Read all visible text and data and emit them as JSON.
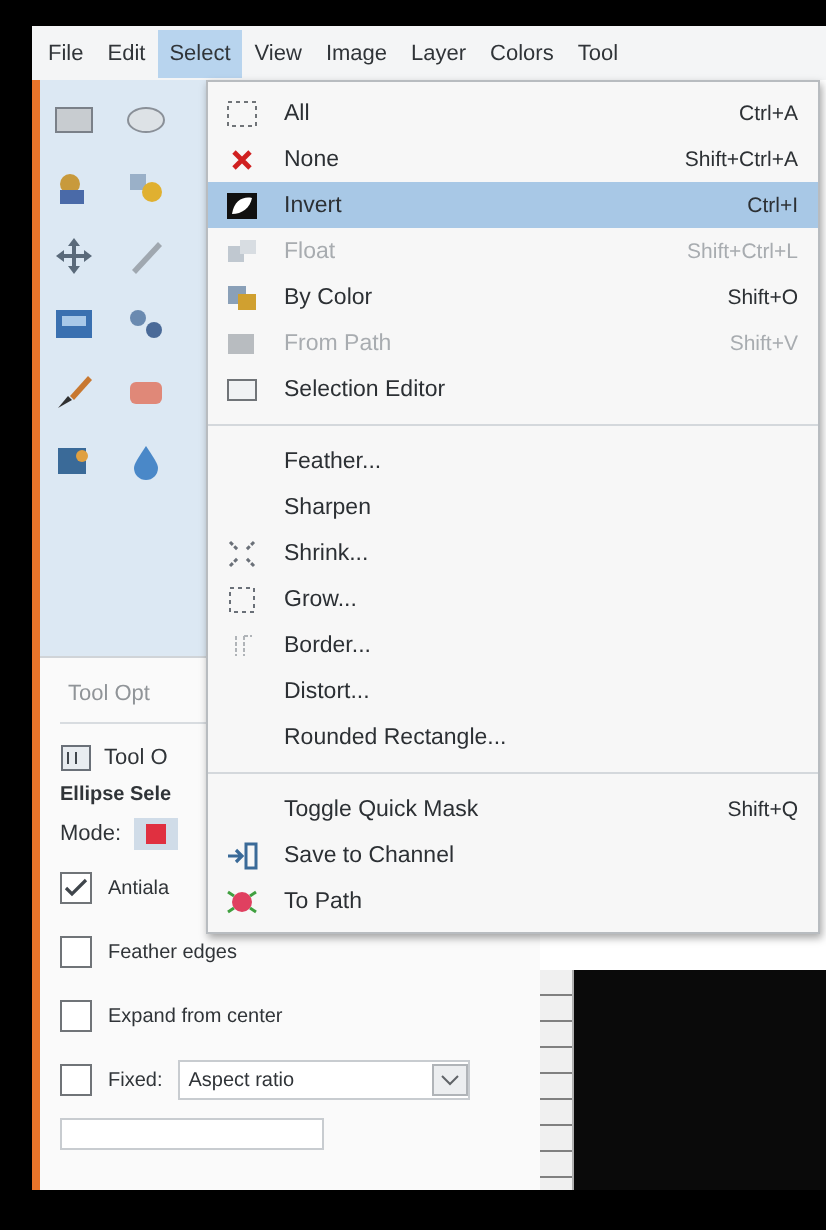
{
  "menubar": [
    {
      "label": "File",
      "selected": false
    },
    {
      "label": "Edit",
      "selected": false
    },
    {
      "label": "Select",
      "selected": true
    },
    {
      "label": "View",
      "selected": false
    },
    {
      "label": "Image",
      "selected": false
    },
    {
      "label": "Layer",
      "selected": false
    },
    {
      "label": "Colors",
      "selected": false
    },
    {
      "label": "Tool",
      "selected": false
    }
  ],
  "toolbox": [
    [
      {
        "kind": "rect"
      },
      {
        "kind": "ellipse"
      }
    ],
    [
      {
        "kind": "fuzzy"
      },
      {
        "kind": "color"
      }
    ],
    [
      {
        "kind": "move"
      },
      {
        "kind": "align"
      }
    ],
    [
      {
        "kind": "crop"
      },
      {
        "kind": "warp"
      }
    ],
    [
      {
        "kind": "brush"
      },
      {
        "kind": "eraser"
      }
    ],
    [
      {
        "kind": "bucket"
      },
      {
        "kind": "drop"
      }
    ]
  ],
  "menu": {
    "sections": [
      [
        {
          "kind": "all",
          "label": "All",
          "shortcut": "Ctrl+A",
          "selected": false,
          "disabled": false
        },
        {
          "kind": "none",
          "label": "None",
          "shortcut": "Shift+Ctrl+A",
          "selected": false,
          "disabled": false
        },
        {
          "kind": "invert",
          "label": "Invert",
          "shortcut": "Ctrl+I",
          "selected": true,
          "disabled": false
        },
        {
          "kind": "float",
          "label": "Float",
          "shortcut": "Shift+Ctrl+L",
          "selected": false,
          "disabled": true
        },
        {
          "kind": "by-color",
          "label": "By Color",
          "shortcut": "Shift+O",
          "selected": false,
          "disabled": false
        },
        {
          "kind": "from-path",
          "label": "From Path",
          "shortcut": "Shift+V",
          "selected": false,
          "disabled": true
        },
        {
          "kind": "editor",
          "label": "Selection Editor",
          "selected": false,
          "disabled": false
        }
      ],
      [
        {
          "kind": "plain",
          "label": "Feather...",
          "selected": false,
          "disabled": false
        },
        {
          "kind": "plain",
          "label": "Sharpen",
          "selected": false,
          "disabled": false
        },
        {
          "kind": "shrink",
          "label": "Shrink...",
          "selected": false,
          "disabled": false
        },
        {
          "kind": "grow",
          "label": "Grow...",
          "selected": false,
          "disabled": false
        },
        {
          "kind": "border",
          "label": "Border...",
          "selected": false,
          "disabled": false
        },
        {
          "kind": "plain",
          "label": "Distort...",
          "selected": false,
          "disabled": false
        },
        {
          "kind": "plain",
          "label": "Rounded Rectangle...",
          "selected": false,
          "disabled": false
        }
      ],
      [
        {
          "kind": "plain",
          "label": "Toggle Quick Mask",
          "shortcut": "Shift+Q",
          "selected": false,
          "disabled": false
        },
        {
          "kind": "channel",
          "label": "Save to Channel",
          "selected": false,
          "disabled": false
        },
        {
          "kind": "path",
          "label": "To Path",
          "selected": false,
          "disabled": false
        }
      ]
    ]
  },
  "tool_options": {
    "tab": "Tool Opt",
    "header": "Tool O",
    "tool_name": "Ellipse Sele",
    "mode_label": "Mode:",
    "checkboxes": [
      {
        "label": "Antiala",
        "checked": true
      },
      {
        "label": "Feather edges",
        "checked": false
      },
      {
        "label": "Expand from center",
        "checked": false
      },
      {
        "label": "Fixed:",
        "checked": false
      }
    ],
    "fixed_dropdown": "Aspect ratio"
  }
}
